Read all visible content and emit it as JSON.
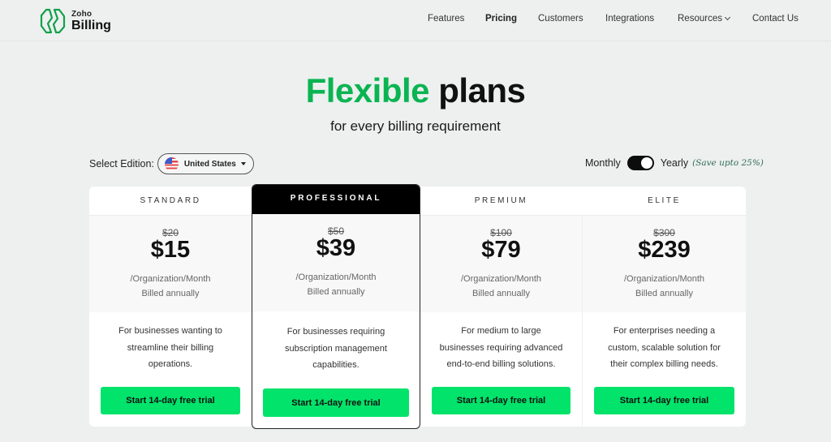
{
  "brand": {
    "company": "Zoho",
    "product": "Billing",
    "icon": "zoho-billing-logo-icon",
    "accent_color": "#0ab452"
  },
  "nav": {
    "items": [
      {
        "label": "Features",
        "active": false
      },
      {
        "label": "Pricing",
        "active": true
      },
      {
        "label": "Customers",
        "active": false
      },
      {
        "label": "Integrations",
        "active": false
      },
      {
        "label": "Resources",
        "active": false,
        "has_dropdown": true
      },
      {
        "label": "Contact Us",
        "active": false
      }
    ]
  },
  "hero": {
    "title_highlight": "Flexible",
    "title_rest": "plans",
    "subtitle": "for every billing requirement"
  },
  "edition": {
    "label": "Select Edition:",
    "selected": "United States",
    "flag_icon": "us-flag-icon"
  },
  "billing_toggle": {
    "left_label": "Monthly",
    "right_label": "Yearly",
    "selected": "Yearly",
    "save_note": "(Save upto 25%)"
  },
  "plans": [
    {
      "name": "STANDARD",
      "old_price": "$20",
      "price": "$15",
      "unit": "/Organization/Month",
      "billing": "Billed annually",
      "description": "For businesses wanting to streamline their billing operations.",
      "cta": "Start 14-day free trial",
      "featured": false
    },
    {
      "name": "PROFESSIONAL",
      "old_price": "$50",
      "price": "$39",
      "unit": "/Organization/Month",
      "billing": "Billed annually",
      "description": "For businesses requiring subscription management capabilities.",
      "cta": "Start 14-day free trial",
      "featured": true
    },
    {
      "name": "PREMIUM",
      "old_price": "$100",
      "price": "$79",
      "unit": "/Organization/Month",
      "billing": "Billed annually",
      "description": "For medium to large businesses requiring advanced end-to-end billing solutions.",
      "cta": "Start 14-day free trial",
      "featured": false
    },
    {
      "name": "ELITE",
      "old_price": "$300",
      "price": "$239",
      "unit": "/Organization/Month",
      "billing": "Billed annually",
      "description": "For enterprises needing a custom, scalable solution for their complex billing needs.",
      "cta": "Start 14-day free trial",
      "featured": false
    }
  ],
  "colors": {
    "cta_green": "#01e36a",
    "featured_header": "#000000",
    "background": "#edf0ef"
  }
}
